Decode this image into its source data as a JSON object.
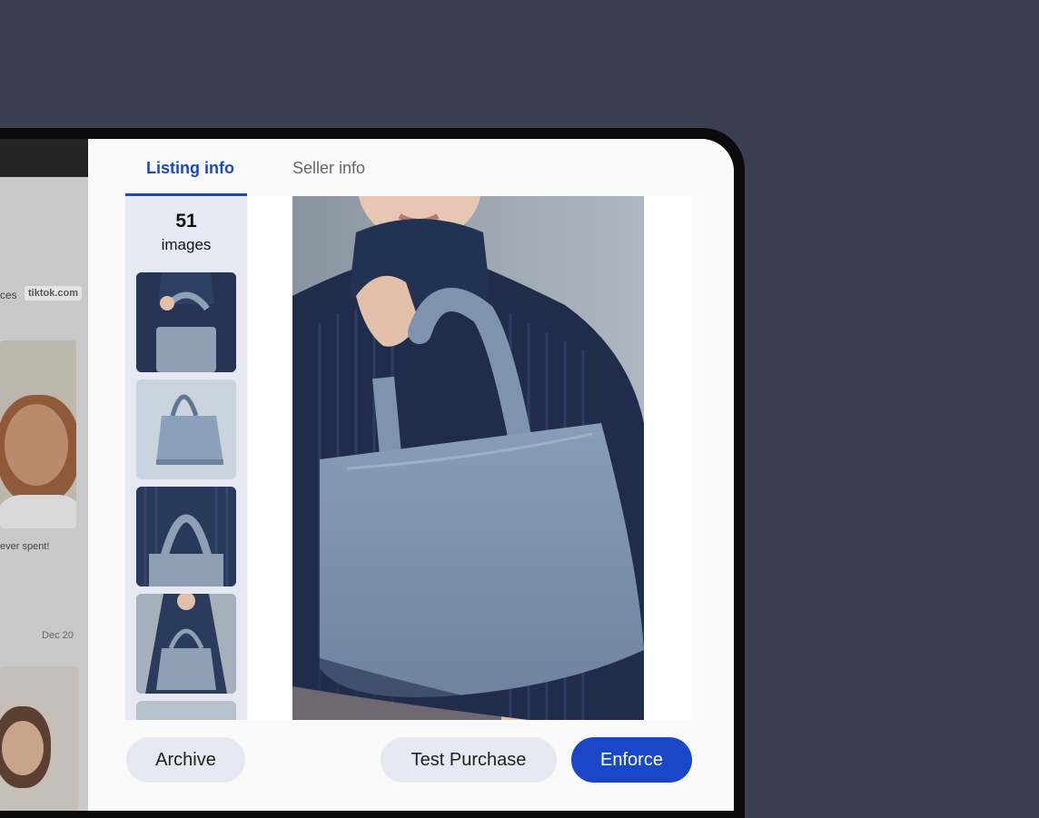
{
  "background_app": {
    "tag_prefix": "ces",
    "tag": "tiktok.com",
    "post_caption": "ever spent!",
    "post_date": "Dec 20"
  },
  "tabs": [
    {
      "label": "Listing info",
      "active": true
    },
    {
      "label": "Seller info",
      "active": false
    }
  ],
  "gallery": {
    "count": "51",
    "count_label": "images"
  },
  "actions": {
    "archive": "Archive",
    "test_purchase": "Test Purchase",
    "enforce": "Enforce"
  },
  "colors": {
    "accent": "#1a47c7",
    "page_bg": "#3a3f52",
    "secondary_button": "#e6e9f1"
  }
}
